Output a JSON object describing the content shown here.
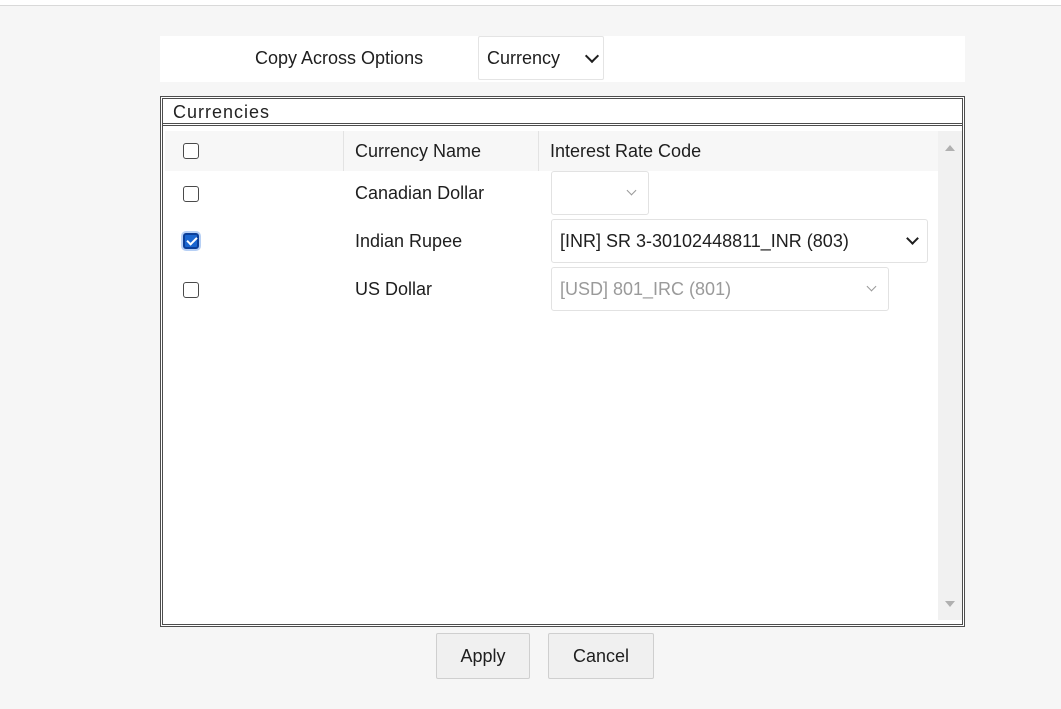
{
  "options": {
    "label": "Copy Across Options",
    "selected": "Currency"
  },
  "panel": {
    "title": "Currencies"
  },
  "grid": {
    "columns": [
      "Currency Name",
      "Interest Rate Code"
    ],
    "rows": [
      {
        "name": "Canadian Dollar",
        "checked": false,
        "rate_code": "",
        "rate_disabled": false
      },
      {
        "name": "Indian Rupee",
        "checked": true,
        "rate_code": "[INR] SR 3-30102448811_INR (803)",
        "rate_disabled": false
      },
      {
        "name": "US Dollar",
        "checked": false,
        "rate_code": "[USD] 801_IRC (801)",
        "rate_disabled": true
      }
    ]
  },
  "buttons": {
    "apply": "Apply",
    "cancel": "Cancel"
  }
}
